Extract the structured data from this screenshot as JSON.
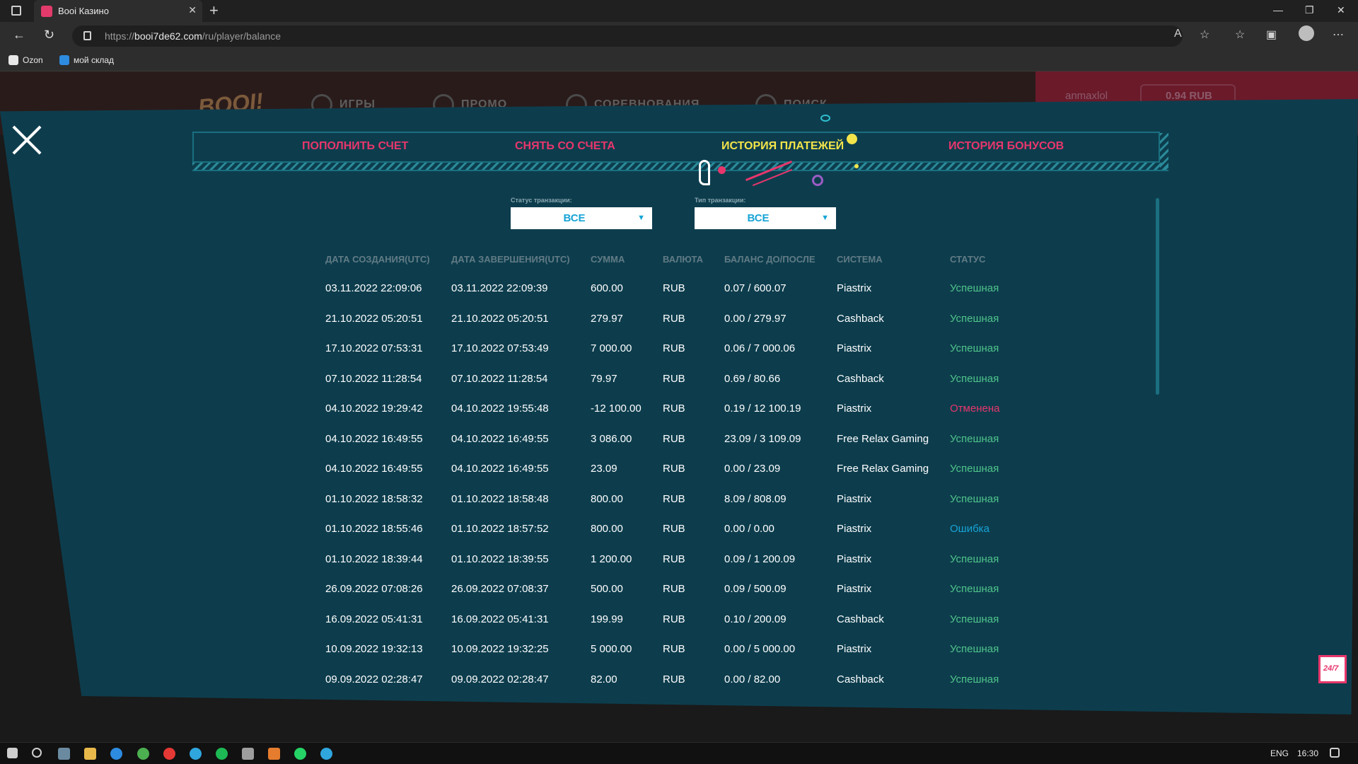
{
  "browser": {
    "tab_title": "Booi Казино",
    "tab_close": "✕",
    "new_tab": "+",
    "url_prefix": "https://",
    "url_host": "booi7de62.com",
    "url_path": "/ru/player/balance",
    "bookmarks": [
      {
        "label": "Ozon",
        "icon": "ozon-icon",
        "color": "#e8e8e8"
      },
      {
        "label": "мой склад",
        "icon": "moysklad-icon",
        "color": "#2d8be0"
      }
    ]
  },
  "site": {
    "logo": "BOOI!",
    "nav": [
      "ИГРЫ",
      "ПРОМО",
      "СОРЕВНОВАНИЯ",
      "ПОИСК"
    ],
    "username": "anmaxlol",
    "balance": "0.94 RUB"
  },
  "modal": {
    "tabs": [
      "ПОПОЛНИТЬ СЧЕТ",
      "СНЯТЬ СО СЧЕТА",
      "ИСТОРИЯ ПЛАТЕЖЕЙ",
      "ИСТОРИЯ БОНУСОВ"
    ],
    "active_tab": 2,
    "filters": {
      "status_label": "Статус транзакции:",
      "status_value": "ВСЕ",
      "type_label": "Тип транзакции:",
      "type_value": "ВСЕ"
    },
    "columns": [
      "ДАТА СОЗДАНИЯ(UTC)",
      "ДАТА ЗАВЕРШЕНИЯ(UTC)",
      "СУММА",
      "ВАЛЮТА",
      "БАЛАНС ДО/ПОСЛЕ",
      "СИСТЕМА",
      "СТАТУС"
    ],
    "rows": [
      [
        "03.11.2022 22:09:06",
        "03.11.2022 22:09:39",
        "600.00",
        "RUB",
        "0.07 / 600.07",
        "Piastrix",
        "Успешная"
      ],
      [
        "21.10.2022 05:20:51",
        "21.10.2022 05:20:51",
        "279.97",
        "RUB",
        "0.00 / 279.97",
        "Cashback",
        "Успешная"
      ],
      [
        "17.10.2022 07:53:31",
        "17.10.2022 07:53:49",
        "7 000.00",
        "RUB",
        "0.06 / 7 000.06",
        "Piastrix",
        "Успешная"
      ],
      [
        "07.10.2022 11:28:54",
        "07.10.2022 11:28:54",
        "79.97",
        "RUB",
        "0.69 / 80.66",
        "Cashback",
        "Успешная"
      ],
      [
        "04.10.2022 19:29:42",
        "04.10.2022 19:55:48",
        "-12 100.00",
        "RUB",
        "0.19 / 12 100.19",
        "Piastrix",
        "Отменена"
      ],
      [
        "04.10.2022 16:49:55",
        "04.10.2022 16:49:55",
        "3 086.00",
        "RUB",
        "23.09 / 3 109.09",
        "Free Relax Gaming",
        "Успешная"
      ],
      [
        "04.10.2022 16:49:55",
        "04.10.2022 16:49:55",
        "23.09",
        "RUB",
        "0.00 / 23.09",
        "Free Relax Gaming",
        "Успешная"
      ],
      [
        "01.10.2022 18:58:32",
        "01.10.2022 18:58:48",
        "800.00",
        "RUB",
        "8.09 / 808.09",
        "Piastrix",
        "Успешная"
      ],
      [
        "01.10.2022 18:55:46",
        "01.10.2022 18:57:52",
        "800.00",
        "RUB",
        "0.00 / 0.00",
        "Piastrix",
        "Ошибка"
      ],
      [
        "01.10.2022 18:39:44",
        "01.10.2022 18:39:55",
        "1 200.00",
        "RUB",
        "0.09 / 1 200.09",
        "Piastrix",
        "Успешная"
      ],
      [
        "26.09.2022 07:08:26",
        "26.09.2022 07:08:37",
        "500.00",
        "RUB",
        "0.09 / 500.09",
        "Piastrix",
        "Успешная"
      ],
      [
        "16.09.2022 05:41:31",
        "16.09.2022 05:41:31",
        "199.99",
        "RUB",
        "0.10 / 200.09",
        "Cashback",
        "Успешная"
      ],
      [
        "10.09.2022 19:32:13",
        "10.09.2022 19:32:25",
        "5 000.00",
        "RUB",
        "0.00 / 5 000.00",
        "Piastrix",
        "Успешная"
      ],
      [
        "09.09.2022 02:28:47",
        "09.09.2022 02:28:47",
        "82.00",
        "RUB",
        "0.00 / 82.00",
        "Cashback",
        "Успешная"
      ]
    ],
    "chat_label": "24/7"
  },
  "taskbar": {
    "lang": "ENG",
    "time": "16:30"
  },
  "colors": {
    "success": "#4fc48a",
    "cancelled": "#e8366c",
    "error": "#16a4d6",
    "accent_pink": "#e8366c",
    "accent_yellow": "#f2e44a"
  }
}
